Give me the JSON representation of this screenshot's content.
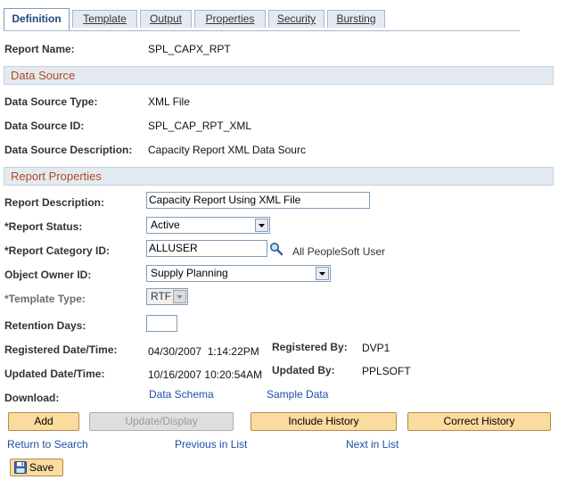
{
  "tabs": [
    {
      "label": "Definition",
      "active": true
    },
    {
      "label": "Template"
    },
    {
      "label": "Output"
    },
    {
      "label": "Properties"
    },
    {
      "label": "Security"
    },
    {
      "label": "Bursting"
    }
  ],
  "report_name": {
    "label": "Report Name:",
    "value": "SPL_CAPX_RPT"
  },
  "data_source": {
    "heading": "Data Source",
    "type": {
      "label": "Data Source Type:",
      "value": "XML File"
    },
    "id": {
      "label": "Data Source ID:",
      "value": "SPL_CAP_RPT_XML"
    },
    "description": {
      "label": "Data Source Description:",
      "value": "Capacity Report XML Data Sourc"
    }
  },
  "report_properties": {
    "heading": "Report Properties",
    "description": {
      "label": "Report Description:",
      "value": "Capacity Report Using XML File"
    },
    "status": {
      "label": "*Report Status:",
      "value": "Active"
    },
    "category": {
      "label": "*Report Category ID:",
      "value": "ALLUSER",
      "description": "All PeopleSoft User"
    },
    "owner": {
      "label": "Object Owner ID:",
      "value": "Supply Planning"
    },
    "template_type": {
      "label": "*Template Type:",
      "value": "RTF"
    },
    "retention": {
      "label": "Retention Days:",
      "value": ""
    },
    "registered_dt": {
      "label": "Registered Date/Time:",
      "value": "04/30/2007  1:14:22PM"
    },
    "registered_by": {
      "label": "Registered By:",
      "value": "DVP1"
    },
    "updated_dt": {
      "label": "Updated Date/Time:",
      "value": "10/16/2007 10:20:54AM"
    },
    "updated_by": {
      "label": "Updated By:",
      "value": "PPLSOFT"
    },
    "download": {
      "label": "Download:",
      "data_schema": "Data Schema",
      "sample_data": "Sample Data"
    }
  },
  "buttons": {
    "add": "Add",
    "update_display": "Update/Display",
    "include_history": "Include History",
    "correct_history": "Correct History"
  },
  "nav": {
    "return_to_search": "Return to Search",
    "previous_in_list": "Previous in List",
    "next_in_list": "Next in List"
  },
  "save": {
    "label": "Save",
    "icon": "floppy-disk-icon"
  },
  "colors": {
    "section_text": "#b04a1f",
    "section_bg": "#e4eaf1",
    "link": "#1f4ea8",
    "button_bg": "#fcdb9f"
  }
}
